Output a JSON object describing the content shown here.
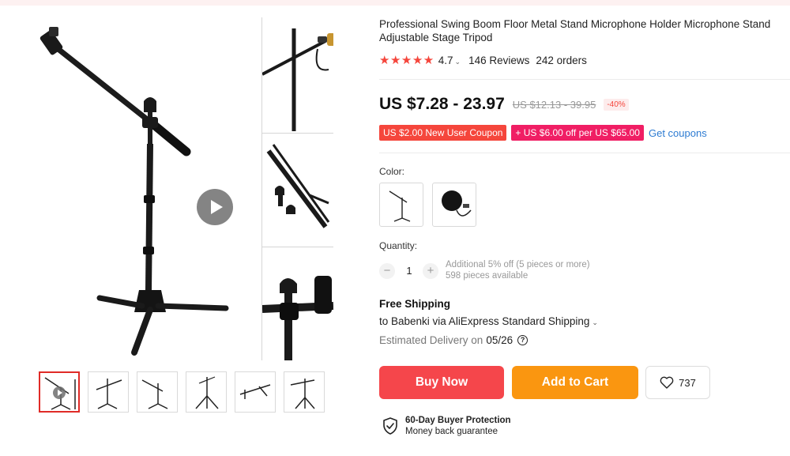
{
  "product": {
    "title": "Professional Swing Boom Floor Metal Stand Microphone Holder Microphone Stand Adjustable Stage Tripod",
    "stars": "★★★★★",
    "rating": "4.7",
    "reviews": "146 Reviews",
    "orders": "242 orders"
  },
  "price": {
    "current": "US $7.28 - 23.97",
    "original": "US $12.13 - 39.95",
    "discount": "-40%"
  },
  "coupons": {
    "new_user": "US $2.00 New User Coupon",
    "store": "+ US $6.00 off per US $65.00",
    "get_coupons": "Get coupons"
  },
  "color": {
    "label": "Color:",
    "options": [
      "boom-stand",
      "pop-filter"
    ]
  },
  "quantity": {
    "label": "Quantity:",
    "minus": "−",
    "value": "1",
    "plus": "+",
    "note_line1": "Additional 5% off (5 pieces or more)",
    "note_line2": "598 pieces available"
  },
  "shipping": {
    "title": "Free Shipping",
    "to": "to Babenki via AliExpress Standard Shipping",
    "estimated_label": "Estimated Delivery on",
    "estimated_date": "05/26",
    "help": "?"
  },
  "actions": {
    "buy_now": "Buy Now",
    "add_to_cart": "Add to Cart",
    "wishlist_count": "737"
  },
  "protection": {
    "title": "60-Day Buyer Protection",
    "subtitle": "Money back guarantee"
  },
  "colors": {
    "accent_red": "#f5463c",
    "buy_now": "#f5464b",
    "add_to_cart": "#fa9610",
    "coupon_pink": "#f01e64",
    "link_blue": "#2d7bd2"
  }
}
